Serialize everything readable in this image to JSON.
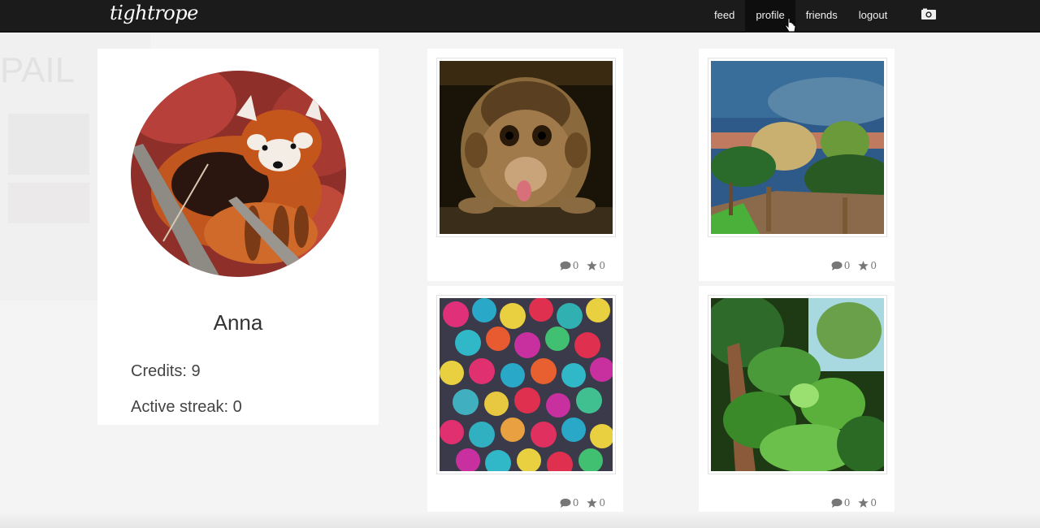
{
  "brand": {
    "name": "tightrope"
  },
  "nav": {
    "items": [
      {
        "label": "feed"
      },
      {
        "label": "profile"
      },
      {
        "label": "friends"
      },
      {
        "label": "logout"
      }
    ],
    "active": "profile",
    "camera_icon": "camera-icon"
  },
  "ghost_overlay": {
    "text": "PAIL"
  },
  "profile": {
    "name": "Anna",
    "credits_label": "Credits: 9",
    "streak_label": "Active streak: 0",
    "avatar_icon": "red-panda-photo"
  },
  "photos": [
    {
      "subject": "monkey-photo",
      "comments": "0",
      "stars": "0"
    },
    {
      "subject": "garden-photo",
      "comments": "0",
      "stars": "0"
    },
    {
      "subject": "umbrellas-photo",
      "comments": "0",
      "stars": "0"
    },
    {
      "subject": "jungle-photo",
      "comments": "0",
      "stars": "0"
    }
  ],
  "icons": {
    "comment": "comment-icon",
    "star": "star-icon"
  },
  "colors": {
    "topbar": "#1b1b1b",
    "page_bg": "#f4f4f4",
    "card_bg": "#ffffff",
    "meta_text": "#777777"
  }
}
